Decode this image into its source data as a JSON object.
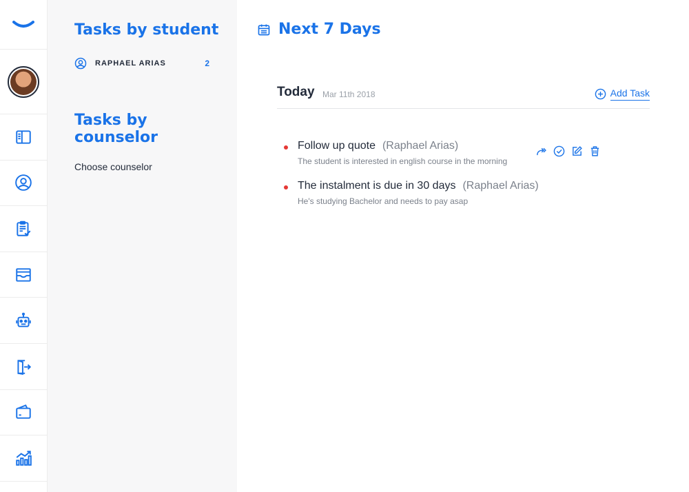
{
  "colors": {
    "accent": "#1a73e8",
    "text": "#232b3a",
    "muted": "#7b818b",
    "dot": "#e53935",
    "panel_bg": "#f7f7f8"
  },
  "rail": {
    "logo_icon": "smile-logo-icon",
    "items": [
      {
        "icon": "panel-icon"
      },
      {
        "icon": "user-circle-icon"
      },
      {
        "icon": "clipboard-check-icon"
      },
      {
        "icon": "archive-icon"
      },
      {
        "icon": "robot-icon"
      },
      {
        "icon": "logout-icon"
      },
      {
        "icon": "wallet-icon"
      },
      {
        "icon": "chart-icon"
      }
    ]
  },
  "left_panel": {
    "students_title": "Tasks by student",
    "students": [
      {
        "name": "RAPHAEL ARIAS",
        "count": "2"
      }
    ],
    "counselor_title": "Tasks by counselor",
    "counselor_placeholder": "Choose counselor"
  },
  "main": {
    "title": "Next 7 Days",
    "day": {
      "label": "Today",
      "date": "Mar 11th 2018",
      "add_task_label": "Add Task",
      "tasks": [
        {
          "title": "Follow up quote",
          "student": "(Raphael Arias)",
          "description": "The student is interested in english course in the morning"
        },
        {
          "title": "The instalment is due in 30 days",
          "student": "(Raphael Arias)",
          "description": "He's studying Bachelor and needs to pay asap"
        }
      ]
    },
    "task_actions": [
      {
        "icon": "forward-icon"
      },
      {
        "icon": "check-circle-icon"
      },
      {
        "icon": "edit-icon"
      },
      {
        "icon": "trash-icon"
      }
    ]
  }
}
